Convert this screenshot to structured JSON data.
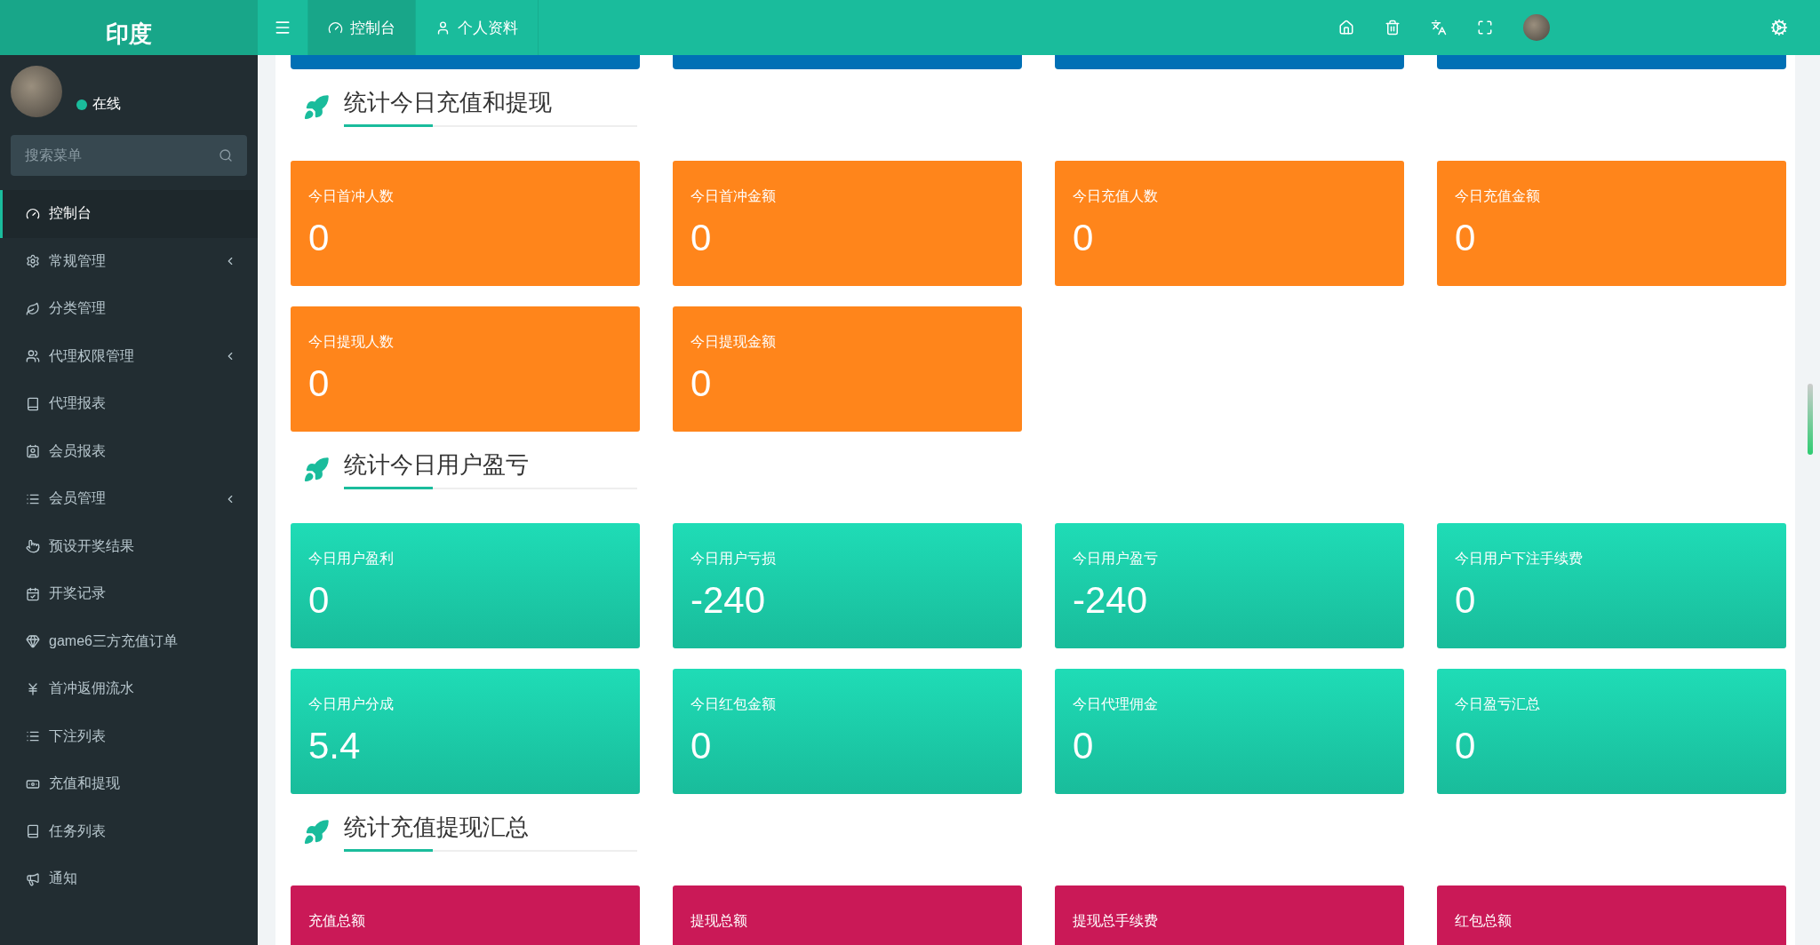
{
  "logo": "印度",
  "nav_tabs": [
    {
      "label": "控制台",
      "selected": true
    },
    {
      "label": "个人资料",
      "selected": false
    }
  ],
  "user": {
    "status": "在线",
    "online": true
  },
  "search": {
    "placeholder": "搜索菜单"
  },
  "sidebar": {
    "items": [
      {
        "label": "控制台",
        "selected": true,
        "submenu": false
      },
      {
        "label": "常规管理",
        "selected": false,
        "submenu": true
      },
      {
        "label": "分类管理",
        "selected": false,
        "submenu": false
      },
      {
        "label": "代理权限管理",
        "selected": false,
        "submenu": true
      },
      {
        "label": "代理报表",
        "selected": false,
        "submenu": false
      },
      {
        "label": "会员报表",
        "selected": false,
        "submenu": false
      },
      {
        "label": "会员管理",
        "selected": false,
        "submenu": true
      },
      {
        "label": "预设开奖结果",
        "selected": false,
        "submenu": false
      },
      {
        "label": "开奖记录",
        "selected": false,
        "submenu": false
      },
      {
        "label": "game6三方充值订单",
        "selected": false,
        "submenu": false
      },
      {
        "label": "首冲返佣流水",
        "selected": false,
        "submenu": false
      },
      {
        "label": "下注列表",
        "selected": false,
        "submenu": false
      },
      {
        "label": "充值和提现",
        "selected": false,
        "submenu": false
      },
      {
        "label": "任务列表",
        "selected": false,
        "submenu": false
      },
      {
        "label": "通知",
        "selected": false,
        "submenu": false
      }
    ]
  },
  "sections": [
    {
      "title": "统计今日充值和提现",
      "kind": "orange",
      "cards": [
        {
          "label": "今日首冲人数",
          "value": "0"
        },
        {
          "label": "今日首冲金额",
          "value": "0"
        },
        {
          "label": "今日充值人数",
          "value": "0"
        },
        {
          "label": "今日充值金额",
          "value": "0"
        },
        {
          "label": "今日提现人数",
          "value": "0"
        },
        {
          "label": "今日提现金额",
          "value": "0"
        }
      ]
    },
    {
      "title": "统计今日用户盈亏",
      "kind": "teal",
      "cards": [
        {
          "label": "今日用户盈利",
          "value": "0"
        },
        {
          "label": "今日用户亏损",
          "value": "-240"
        },
        {
          "label": "今日用户盈亏",
          "value": "-240"
        },
        {
          "label": "今日用户下注手续费",
          "value": "0"
        },
        {
          "label": "今日用户分成",
          "value": "5.4"
        },
        {
          "label": "今日红包金额",
          "value": "0"
        },
        {
          "label": "今日代理佣金",
          "value": "0"
        },
        {
          "label": "今日盈亏汇总",
          "value": "0"
        }
      ]
    },
    {
      "title": "统计充值提现汇总",
      "kind": "pink",
      "cards": [
        {
          "label": "充值总额"
        },
        {
          "label": "提现总额"
        },
        {
          "label": "提现总手续费"
        },
        {
          "label": "红包总额"
        }
      ]
    }
  ]
}
